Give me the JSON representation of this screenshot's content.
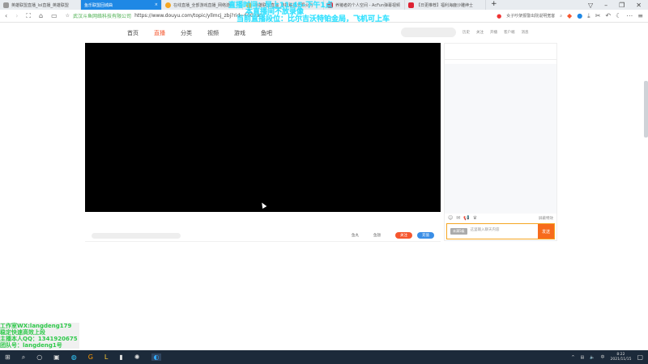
{
  "browser": {
    "tabs": [
      {
        "label": "英雄联盟直播_lol直播_英雄联盟",
        "active": false
      },
      {
        "label": "鱼乐联盟回城曲",
        "active": true
      },
      {
        "label": "在线直播_全部游戏直播_网络游戏",
        "active": false
      },
      {
        "label": "英雄联盟直播_英雄联盟无限火力",
        "active": false
      },
      {
        "label": "养猪者的个人空间 - AcFun弹幕视频",
        "active": false
      },
      {
        "label": "【日更推荐】福利海鹿沙雕绅士",
        "active": false
      }
    ],
    "company": "武汉斗鱼网络科技有限公司",
    "url": "https://www.douyu.com/topic/yllmcj_zbj?rid=600290",
    "search_text": "女子吵架报警出院说明宽客",
    "new_tab": "+"
  },
  "nav": [
    "首页",
    "直播",
    "分类",
    "视频",
    "游戏",
    "鱼吧"
  ],
  "nav_active": 1,
  "top_right": [
    "历史",
    "关注",
    "开播",
    "客户端",
    "消息"
  ],
  "bottom_bar": {
    "items": [
      "鱼丸",
      "鱼翅"
    ],
    "follow": "关注",
    "recharge": "充值"
  },
  "chat": {
    "more": "屏蔽特效",
    "level": "未满5级",
    "placeholder": "这里输入聊天内容",
    "send": "发送"
  },
  "overlay": [
    "直播时间：早上11:45-下午1点",
    "本直播间不放录像",
    "当前直播段位：比尔吉沃特铂金局，飞机可上车"
  ],
  "watermark": [
    "工作室WX:langdeng179",
    "稳定快速高效上段",
    "主播本人QQ：1341920675",
    "团队号：langdeng1号"
  ],
  "taskbar": {
    "time": "8:22",
    "date": "2021/11/15",
    "ime": "中"
  },
  "colors": {
    "accent": "#f5562e",
    "tab_active": "#1e88e5",
    "send": "#f76b1c",
    "recharge": "#3a8ee6"
  }
}
